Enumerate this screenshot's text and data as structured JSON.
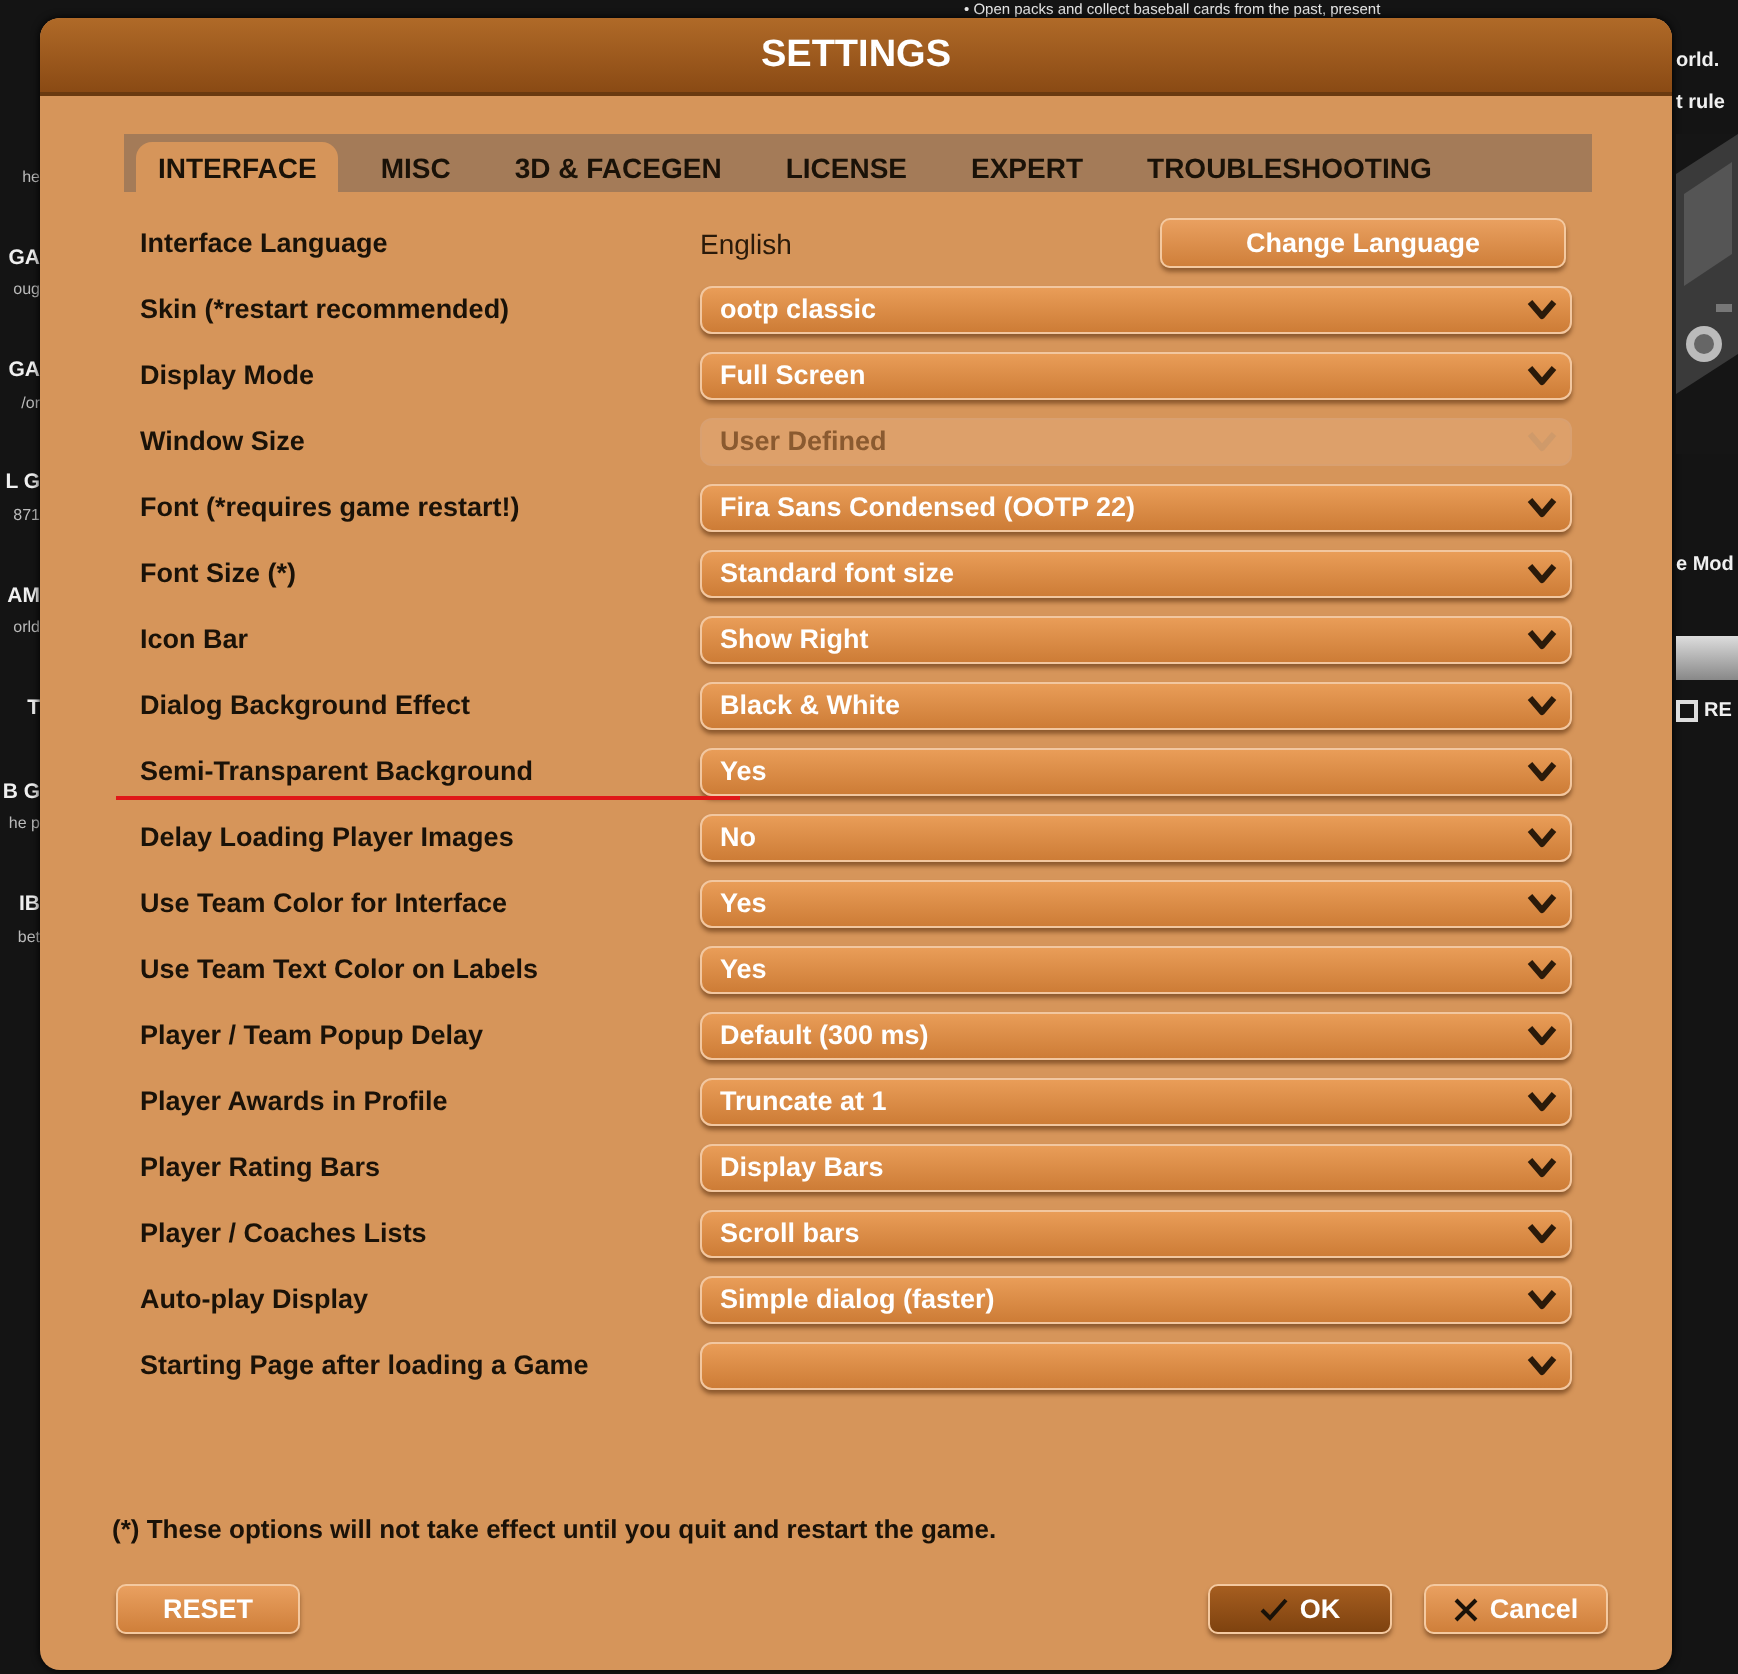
{
  "background": {
    "top_line": "• Open packs and collect baseball cards from the past, present",
    "left_fragments": [
      {
        "text": "he",
        "kind": "sub"
      },
      {
        "text": "GA",
        "kind": "head"
      },
      {
        "text": "oug",
        "kind": "sub"
      },
      {
        "text": "GA",
        "kind": "head"
      },
      {
        "text": "/or",
        "kind": "sub"
      },
      {
        "text": "L G",
        "kind": "head"
      },
      {
        "text": "871",
        "kind": "sub"
      },
      {
        "text": "AM",
        "kind": "head"
      },
      {
        "text": "orld",
        "kind": "sub"
      },
      {
        "text": "T",
        "kind": "head"
      },
      {
        "text": "B G",
        "kind": "head"
      },
      {
        "text": "he p",
        "kind": "sub"
      },
      {
        "text": "IB",
        "kind": "head"
      },
      {
        "text": "bet",
        "kind": "sub"
      }
    ],
    "right_fragments": [
      "orld.",
      "t rule",
      "e Mod"
    ],
    "checkbox": {
      "label": "RE",
      "checked": false
    }
  },
  "dialog": {
    "title": "SETTINGS",
    "tabs": [
      {
        "label": "INTERFACE",
        "selected": true
      },
      {
        "label": "MISC",
        "selected": false
      },
      {
        "label": "3D & FACEGEN",
        "selected": false
      },
      {
        "label": "LICENSE",
        "selected": false
      },
      {
        "label": "EXPERT",
        "selected": false
      },
      {
        "label": "TROUBLESHOOTING",
        "selected": false
      }
    ],
    "rows": [
      {
        "label": "Interface Language",
        "kind": "text",
        "value": "English",
        "button": "Change Language",
        "underlined": false
      },
      {
        "label": "Skin (*restart recommended)",
        "kind": "select",
        "value": "ootp classic",
        "disabled": false,
        "underlined": false
      },
      {
        "label": "Display Mode",
        "kind": "select",
        "value": "Full Screen",
        "disabled": false,
        "underlined": false
      },
      {
        "label": "Window Size",
        "kind": "select",
        "value": "User Defined",
        "disabled": true,
        "underlined": false
      },
      {
        "label": "Font (*requires game restart!)",
        "kind": "select",
        "value": "Fira Sans Condensed (OOTP 22)",
        "disabled": false,
        "underlined": false
      },
      {
        "label": "Font Size (*)",
        "kind": "select",
        "value": "Standard font size",
        "disabled": false,
        "underlined": false
      },
      {
        "label": "Icon Bar",
        "kind": "select",
        "value": "Show Right",
        "disabled": false,
        "underlined": false
      },
      {
        "label": "Dialog Background Effect",
        "kind": "select",
        "value": "Black & White",
        "disabled": false,
        "underlined": false
      },
      {
        "label": "Semi-Transparent Background",
        "kind": "select",
        "value": "Yes",
        "disabled": false,
        "underlined": true
      },
      {
        "label": "Delay Loading Player Images",
        "kind": "select",
        "value": "No",
        "disabled": false,
        "underlined": false
      },
      {
        "label": "Use Team Color for Interface",
        "kind": "select",
        "value": "Yes",
        "disabled": false,
        "underlined": false
      },
      {
        "label": "Use Team Text Color on Labels",
        "kind": "select",
        "value": "Yes",
        "disabled": false,
        "underlined": false
      },
      {
        "label": "Player / Team Popup Delay",
        "kind": "select",
        "value": "Default (300 ms)",
        "disabled": false,
        "underlined": false
      },
      {
        "label": "Player Awards in Profile",
        "kind": "select",
        "value": "Truncate at 1",
        "disabled": false,
        "underlined": false
      },
      {
        "label": "Player Rating Bars",
        "kind": "select",
        "value": "Display Bars",
        "disabled": false,
        "underlined": false
      },
      {
        "label": "Player / Coaches Lists",
        "kind": "select",
        "value": "Scroll bars",
        "disabled": false,
        "underlined": false
      },
      {
        "label": "Auto-play Display",
        "kind": "select",
        "value": "Simple dialog (faster)",
        "disabled": false,
        "underlined": false
      },
      {
        "label": "Starting Page after loading a Game",
        "kind": "select",
        "disabled": false,
        "underlined": false
      }
    ],
    "note": "(*) These options will not take effect until you quit and restart the game.",
    "buttons": [
      {
        "label": "RESET",
        "kind": "plain"
      },
      {
        "label": "OK",
        "kind": "ok"
      },
      {
        "label": "Cancel",
        "kind": "cancel"
      }
    ]
  }
}
